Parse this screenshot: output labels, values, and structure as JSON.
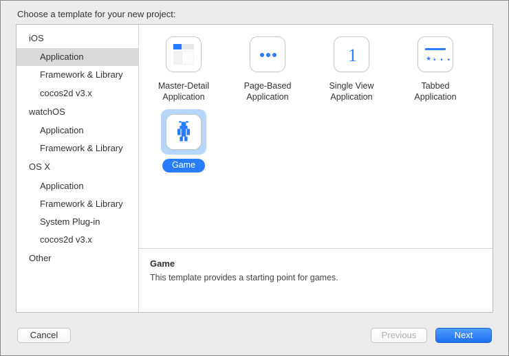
{
  "header": {
    "title": "Choose a template for your new project:"
  },
  "sidebar": {
    "groups": [
      {
        "label": "iOS",
        "items": [
          {
            "label": "Application",
            "selected": true
          },
          {
            "label": "Framework & Library"
          },
          {
            "label": "cocos2d v3.x"
          }
        ]
      },
      {
        "label": "watchOS",
        "items": [
          {
            "label": "Application"
          },
          {
            "label": "Framework & Library"
          }
        ]
      },
      {
        "label": "OS X",
        "items": [
          {
            "label": "Application"
          },
          {
            "label": "Framework & Library"
          },
          {
            "label": "System Plug-in"
          },
          {
            "label": "cocos2d v3.x"
          }
        ]
      },
      {
        "label": "Other",
        "items": []
      }
    ]
  },
  "templates": [
    {
      "id": "master-detail",
      "label_line1": "Master-Detail",
      "label_line2": "Application"
    },
    {
      "id": "page-based",
      "label_line1": "Page-Based",
      "label_line2": "Application"
    },
    {
      "id": "single-view",
      "label_line1": "Single View",
      "label_line2": "Application"
    },
    {
      "id": "tabbed",
      "label_line1": "Tabbed",
      "label_line2": "Application"
    },
    {
      "id": "game",
      "label_line1": "Game",
      "selected": true
    }
  ],
  "detail": {
    "title": "Game",
    "description": "This template provides a starting point for games."
  },
  "footer": {
    "cancel": "Cancel",
    "previous": "Previous",
    "next": "Next"
  },
  "colors": {
    "accent": "#2a7cff"
  }
}
